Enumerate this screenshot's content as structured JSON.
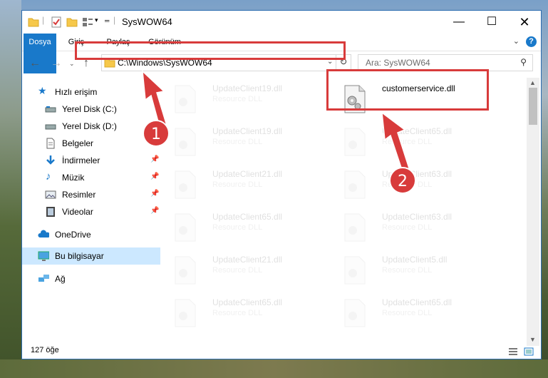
{
  "window": {
    "title": "SysWOW64"
  },
  "ribbon": {
    "tabs": [
      "Dosya",
      "Giriş",
      "Paylaş",
      "Görünüm"
    ]
  },
  "address": {
    "path": "C:\\Windows\\SysWOW64"
  },
  "search": {
    "placeholder": "Ara: SysWOW64"
  },
  "sidebar": {
    "items": [
      {
        "label": "Hızlı erişim",
        "icon": "star-icon"
      },
      {
        "label": "Yerel Disk (C:)",
        "icon": "drive-icon"
      },
      {
        "label": "Yerel Disk (D:)",
        "icon": "drive-icon"
      },
      {
        "label": "Belgeler",
        "icon": "document-icon"
      },
      {
        "label": "İndirmeler",
        "icon": "download-icon"
      },
      {
        "label": "Müzik",
        "icon": "music-icon"
      },
      {
        "label": "Resimler",
        "icon": "pictures-icon"
      },
      {
        "label": "Videolar",
        "icon": "video-icon"
      },
      {
        "label": "OneDrive",
        "icon": "cloud-icon"
      },
      {
        "label": "Bu bilgisayar",
        "icon": "computer-icon"
      },
      {
        "label": "Ağ",
        "icon": "network-icon"
      }
    ]
  },
  "files": {
    "left": [
      {
        "name": "UpdateClient19.dll",
        "type": "Resource DLL"
      },
      {
        "name": "UpdateClient19.dll",
        "type": "Resource DLL"
      },
      {
        "name": "UpdateClient21.dll",
        "type": "Resource DLL"
      },
      {
        "name": "UpdateClient65.dll",
        "type": "Resource DLL"
      },
      {
        "name": "UpdateClient21.dll",
        "type": "Resource DLL"
      },
      {
        "name": "UpdateClient65.dll",
        "type": "Resource DLL"
      }
    ],
    "right": [
      {
        "name": "customerservice.dll",
        "type": ""
      },
      {
        "name": "UpdateClient65.dll",
        "type": "Resource DLL"
      },
      {
        "name": "UpdateClient63.dll",
        "type": "Resource DLL"
      },
      {
        "name": "UpdateClient63.dll",
        "type": "Resource DLL"
      },
      {
        "name": "UpdateClient5.dll",
        "type": "Resource DLL"
      },
      {
        "name": "UpdateClient65.dll",
        "type": "Resource DLL"
      }
    ]
  },
  "status": {
    "count": "127 öğe"
  },
  "annotations": {
    "badge1": "1",
    "badge2": "2"
  },
  "colors": {
    "accent": "#1979ca",
    "highlight": "#d83b3b",
    "selection": "#cce8ff"
  }
}
